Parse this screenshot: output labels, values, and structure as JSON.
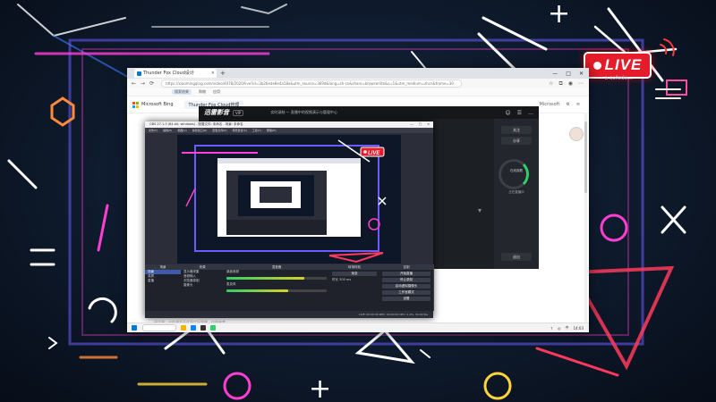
{
  "live_badge": {
    "text": "LIVE",
    "subtext": "···· a sofodo..."
  },
  "browser": {
    "tab_title": "Thunder Fox Cloud设计",
    "new_tab": "+",
    "window_controls": [
      "—",
      "□",
      "✕"
    ],
    "url": "https://xiaomingqing.com/video/4078/2020/live?id=3b26ede8e4a18a&utm_source=369d&lang=zh-cn&share=browserlite&s=1&utm_medium=zhcn&frame=30",
    "favorites": [
      "搜索结果",
      "购物",
      "应用"
    ],
    "bing_label": "Microsoft Bing",
    "page_tab": "Thunder Fox Cloud管理",
    "page_nav_right": [
      "Microsoft",
      "⚙",
      "≡"
    ]
  },
  "player": {
    "logo": "迅雷影音",
    "tag": "VIP",
    "title": "实时录制 — 直播中的视频演示与管理中心",
    "header_right": [
      "☺",
      "☰",
      "…"
    ],
    "side_buttons": [
      "关注",
      "分享",
      "退出"
    ],
    "ring_title": "在线观看",
    "ring_label": "正在直播中"
  },
  "obs": {
    "title": "OBS 27.1.3 (64-bit, windows) - 配置文件: 未命名 - 场景: 未命名",
    "title_controls": [
      "—",
      "□",
      "✕"
    ],
    "menu": [
      "文件(F)",
      "编辑(E)",
      "视图(V)",
      "停靠窗口(D)",
      "配置文件(P)",
      "场景集合(S)",
      "工具(T)",
      "帮助(H)"
    ],
    "docks": {
      "scenes": {
        "header": "场景",
        "items": [
          "场景",
          "录屏",
          "直播"
        ]
      },
      "sources": {
        "header": "来源",
        "items": [
          "显示器采集",
          "音频输入",
          "浏览器录制",
          "摄像头"
        ]
      },
      "mixer": {
        "header": "混音器",
        "channels": [
          {
            "name": "桌面音频",
            "level": 0.78
          },
          {
            "name": "麦克风",
            "level": 0.62
          }
        ]
      },
      "transitions": {
        "header": "转场特效",
        "type": "渐变",
        "duration_label": "时长",
        "duration": "300 ms"
      },
      "controls": {
        "header": "控制",
        "buttons": [
          "开始直播",
          "停止录制",
          "启动虚拟摄像头",
          "工作室模式",
          "设置",
          "退出"
        ]
      }
    },
    "status": "LIVE: 00:00:00   REC: 00:00:00   CPU: 1.4%, 30.00 fps",
    "caption": "请注意：这些源并不代表实际效果，仅供参考"
  },
  "taskbar": {
    "right": [
      "↑",
      "◎",
      "中",
      "14:03"
    ]
  }
}
